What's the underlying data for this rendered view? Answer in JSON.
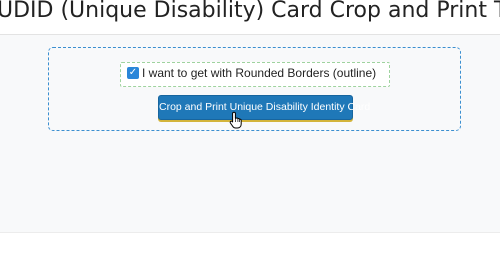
{
  "header": {
    "title": "UDID (Unique Disability) Card Crop and Print Tool"
  },
  "panel": {
    "rounded_borders_option": {
      "checked": true,
      "label": "I want to get with Rounded Borders (outline)"
    },
    "crop_button_label": "Crop and Print Unique Disability Identity Card"
  },
  "cursor": {
    "icon": "hand-pointer-icon"
  },
  "colors": {
    "button_bg": "#1f78b8",
    "panel_border": "#3b8fd0",
    "option_border": "#9fd39f",
    "checkbox": "#2a86d9"
  }
}
